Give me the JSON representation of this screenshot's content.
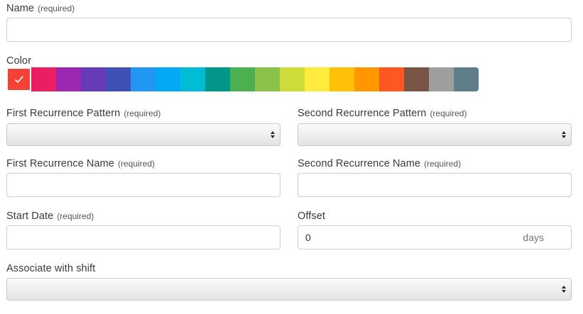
{
  "form": {
    "name": {
      "label": "Name",
      "required": "(required)",
      "value": ""
    },
    "color": {
      "label": "Color",
      "selected_index": 0,
      "swatches": [
        "#f44336",
        "#e91e63",
        "#9c27b0",
        "#673ab7",
        "#3f51b5",
        "#2196f3",
        "#03a9f4",
        "#00bcd4",
        "#009688",
        "#4caf50",
        "#8bc34a",
        "#cddc39",
        "#ffeb3b",
        "#ffc107",
        "#ff9800",
        "#ff5722",
        "#795548",
        "#9e9e9e",
        "#607d8b"
      ]
    },
    "first_pattern": {
      "label": "First Recurrence Pattern",
      "required": "(required)",
      "value": ""
    },
    "second_pattern": {
      "label": "Second Recurrence Pattern",
      "required": "(required)",
      "value": ""
    },
    "first_name": {
      "label": "First Recurrence Name",
      "required": "(required)",
      "value": ""
    },
    "second_name": {
      "label": "Second Recurrence Name",
      "required": "(required)",
      "value": ""
    },
    "start_date": {
      "label": "Start Date",
      "required": "(required)",
      "value": ""
    },
    "offset": {
      "label": "Offset",
      "value": "0",
      "unit": "days"
    },
    "shift": {
      "label": "Associate with shift",
      "value": ""
    }
  }
}
